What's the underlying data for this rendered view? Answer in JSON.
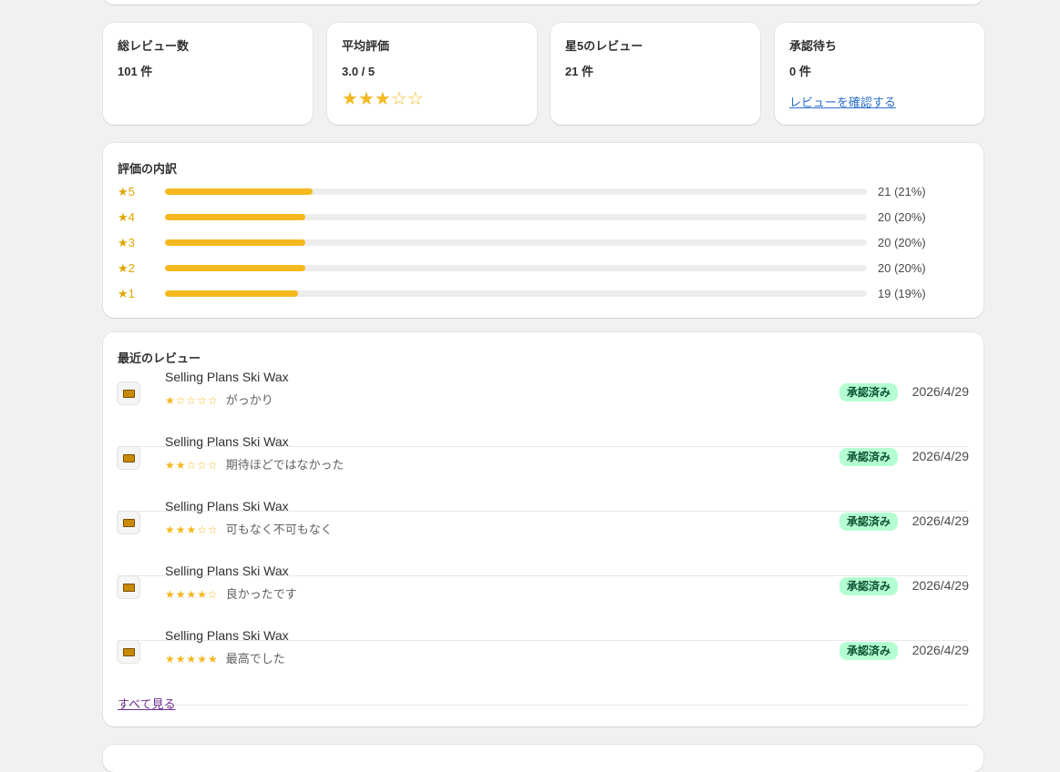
{
  "stats": [
    {
      "title": "総レビュー数",
      "value": "101 件"
    },
    {
      "title": "平均評価",
      "value": "3.0 / 5",
      "stars_filled": 3,
      "stars_total": 5
    },
    {
      "title": "星5のレビュー",
      "value": "21 件"
    },
    {
      "title": "承認待ち",
      "value": "0 件",
      "link": "レビューを確認する"
    }
  ],
  "distribution": {
    "title": "評価の内訳",
    "rows": [
      {
        "label": "★5",
        "fraction": 0.21,
        "count": "21 (21%)"
      },
      {
        "label": "★4",
        "fraction": 0.2,
        "count": "20 (20%)"
      },
      {
        "label": "★3",
        "fraction": 0.2,
        "count": "20 (20%)"
      },
      {
        "label": "★2",
        "fraction": 0.2,
        "count": "20 (20%)"
      },
      {
        "label": "★1",
        "fraction": 0.19,
        "count": "19 (19%)"
      }
    ]
  },
  "recent": {
    "title": "最近のレビュー",
    "items": [
      {
        "product": "Selling Plans Ski Wax",
        "stars": "★☆☆☆☆",
        "rating": 1,
        "text": "がっかり",
        "status": "承認済み",
        "date": "2026/4/29"
      },
      {
        "product": "Selling Plans Ski Wax",
        "stars": "★★☆☆☆",
        "rating": 2,
        "text": "期待ほどではなかった",
        "status": "承認済み",
        "date": "2026/4/29"
      },
      {
        "product": "Selling Plans Ski Wax",
        "stars": "★★★☆☆",
        "rating": 3,
        "text": "可もなく不可もなく",
        "status": "承認済み",
        "date": "2026/4/29"
      },
      {
        "product": "Selling Plans Ski Wax",
        "stars": "★★★★☆",
        "rating": 4,
        "text": "良かったです",
        "status": "承認済み",
        "date": "2026/4/29"
      },
      {
        "product": "Selling Plans Ski Wax",
        "stars": "★★★★★",
        "rating": 5,
        "text": "最高でした",
        "status": "承認済み",
        "date": "2026/4/29"
      }
    ],
    "see_all": "すべて見る"
  },
  "colors": {
    "star": "#f5b81f",
    "badge_bg": "#b4fed2",
    "badge_text": "#0c5132",
    "link": "#2c6ecb"
  }
}
